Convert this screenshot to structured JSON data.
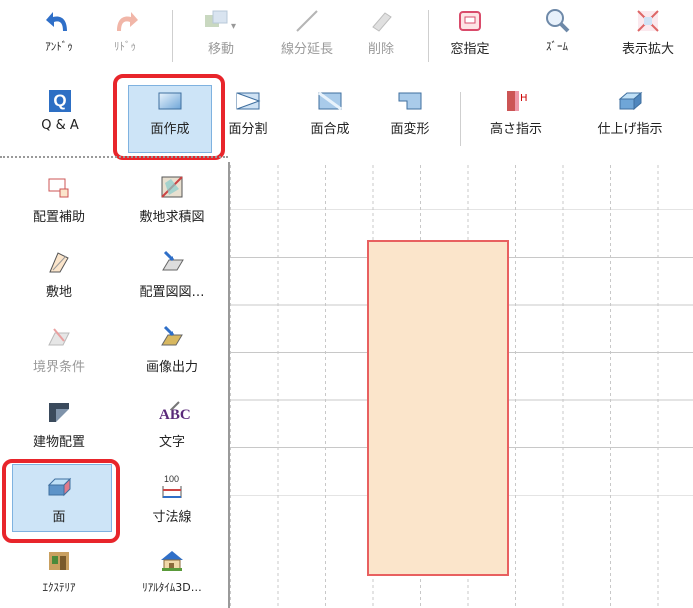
{
  "toolbar": {
    "row1": [
      {
        "name": "undo",
        "label": "ｱﾝﾄﾞｩ",
        "small": true,
        "disabled": false,
        "icon": "undo-icon"
      },
      {
        "name": "redo",
        "label": "ﾘﾄﾞｩ",
        "small": true,
        "disabled": true,
        "icon": "redo-icon"
      },
      {
        "name": "move",
        "label": "移動",
        "small": false,
        "disabled": true,
        "icon": "move-icon"
      },
      {
        "name": "extend-line",
        "label": "線分延長",
        "small": false,
        "disabled": true,
        "icon": "extend-line-icon"
      },
      {
        "name": "delete",
        "label": "削除",
        "small": false,
        "disabled": true,
        "icon": "eraser-icon"
      },
      {
        "name": "window-select",
        "label": "窓指定",
        "small": false,
        "disabled": false,
        "icon": "window-select-icon"
      },
      {
        "name": "zoom",
        "label": "ｽﾞｰﾑ",
        "small": true,
        "disabled": false,
        "icon": "magnifier-icon"
      },
      {
        "name": "display-expand",
        "label": "表示拡大",
        "small": false,
        "disabled": false,
        "icon": "expand-icon"
      }
    ],
    "row2": [
      {
        "name": "qa",
        "label": "Q & A",
        "icon": "qa-icon"
      },
      {
        "name": "create-face",
        "label": "面作成",
        "icon": "face-create-icon"
      },
      {
        "name": "split-face",
        "label": "面分割",
        "icon": "face-split-icon"
      },
      {
        "name": "merge-face",
        "label": "面合成",
        "icon": "face-merge-icon"
      },
      {
        "name": "transform-face",
        "label": "面変形",
        "icon": "face-transform-icon"
      },
      {
        "name": "height-spec",
        "label": "高さ指示",
        "icon": "height-icon"
      },
      {
        "name": "finish-spec",
        "label": "仕上げ指示",
        "icon": "finish-icon"
      }
    ]
  },
  "panel": {
    "items": [
      {
        "name": "placement-aid",
        "label": "配置補助",
        "disabled": false,
        "small": false,
        "icon": "placement-aid-icon"
      },
      {
        "name": "site-area-chart",
        "label": "敷地求積図",
        "disabled": false,
        "small": false,
        "icon": "site-area-icon"
      },
      {
        "name": "site",
        "label": "敷地",
        "disabled": false,
        "small": false,
        "icon": "site-icon"
      },
      {
        "name": "layout-drawing",
        "label": "配置図図…",
        "disabled": false,
        "small": false,
        "icon": "layout-drawing-icon"
      },
      {
        "name": "boundary-condition",
        "label": "境界条件",
        "disabled": true,
        "small": false,
        "icon": "boundary-icon"
      },
      {
        "name": "image-output",
        "label": "画像出力",
        "disabled": false,
        "small": false,
        "icon": "image-output-icon"
      },
      {
        "name": "building-layout",
        "label": "建物配置",
        "disabled": false,
        "small": false,
        "icon": "building-layout-icon"
      },
      {
        "name": "text",
        "label": "文字",
        "disabled": false,
        "small": false,
        "icon": "abc-text-icon"
      },
      {
        "name": "face",
        "label": "面",
        "disabled": false,
        "small": false,
        "icon": "face-icon"
      },
      {
        "name": "dimension-line",
        "label": "寸法線",
        "disabled": false,
        "small": false,
        "icon": "dimension-line-icon"
      },
      {
        "name": "exterior",
        "label": "ｴｸｽﾃﾘｱ",
        "disabled": false,
        "small": true,
        "icon": "exterior-icon"
      },
      {
        "name": "realtime-3d",
        "label": "ﾘｱﾙﾀｲﾑ3D…",
        "disabled": false,
        "small": true,
        "icon": "house-3d-icon"
      }
    ]
  },
  "dimension_icon_text": "100",
  "text_icon_text": "ABC",
  "qa_icon_text": "Q",
  "colors": {
    "highlight": "#e8252b",
    "selected_bg": "#cde4f7",
    "face_fill": "#fbe5cb",
    "face_border": "#e86060"
  }
}
